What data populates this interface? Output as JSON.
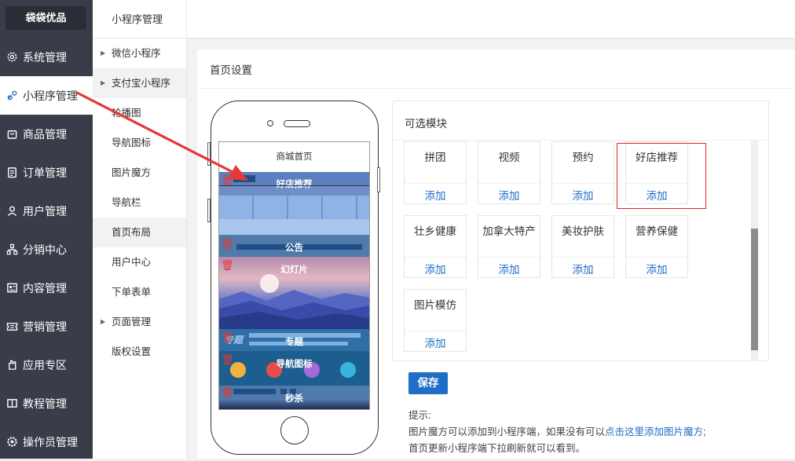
{
  "brand": "袋袋优品",
  "sidebar": {
    "items": [
      {
        "label": "系统管理",
        "icon": "gear-icon"
      },
      {
        "label": "小程序管理",
        "icon": "link-icon"
      },
      {
        "label": "商品管理",
        "icon": "bag-icon"
      },
      {
        "label": "订单管理",
        "icon": "clipboard-icon"
      },
      {
        "label": "用户管理",
        "icon": "user-icon"
      },
      {
        "label": "分销中心",
        "icon": "network-icon"
      },
      {
        "label": "内容管理",
        "icon": "document-icon"
      },
      {
        "label": "营销管理",
        "icon": "ticket-icon"
      },
      {
        "label": "应用专区",
        "icon": "hand-icon"
      },
      {
        "label": "教程管理",
        "icon": "book-icon"
      },
      {
        "label": "操作员管理",
        "icon": "gear-icon"
      }
    ]
  },
  "submenu": {
    "title": "小程序管理",
    "items": [
      {
        "label": "微信小程序"
      },
      {
        "label": "支付宝小程序"
      },
      {
        "label": "轮播图"
      },
      {
        "label": "导航图标"
      },
      {
        "label": "图片魔方"
      },
      {
        "label": "导航栏"
      },
      {
        "label": "首页布局"
      },
      {
        "label": "用户中心"
      },
      {
        "label": "下单表单"
      },
      {
        "label": "页面管理"
      },
      {
        "label": "版权设置"
      }
    ]
  },
  "page": {
    "title": "首页设置",
    "phone": {
      "screen_title": "商城首页",
      "blocks": [
        "好店推荐",
        "公告",
        "幻灯片",
        "专题",
        "导航图标",
        "秒杀"
      ],
      "topic_watermark": "专题"
    },
    "modules": {
      "title": "可选模块",
      "items": [
        {
          "name": "拼团",
          "action": "添加"
        },
        {
          "name": "视频",
          "action": "添加"
        },
        {
          "name": "预约",
          "action": "添加"
        },
        {
          "name": "好店推荐",
          "action": "添加"
        },
        {
          "name": "壮乡健康",
          "action": "添加"
        },
        {
          "name": "加拿大特产",
          "action": "添加"
        },
        {
          "name": "美妆护肤",
          "action": "添加"
        },
        {
          "name": "营养保健",
          "action": "添加"
        },
        {
          "name": "图片模仿",
          "action": "添加"
        }
      ]
    },
    "save_label": "保存",
    "tips": {
      "heading": "提示:",
      "line1_prefix": "图片魔方可以添加到小程序端，如果没有可以",
      "line1_link": "点击这里添加图片魔方",
      "line1_suffix": ";",
      "line2": "首页更新小程序端下拉刷新就可以看到。"
    }
  },
  "colors": {
    "sidebar": "#393d49",
    "accent": "#1e6dc6",
    "highlight": "#d9282f",
    "arrow": "#e53935"
  }
}
